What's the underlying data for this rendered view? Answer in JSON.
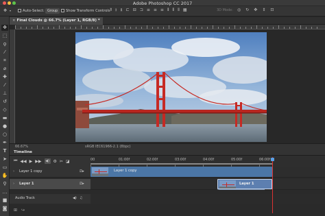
{
  "window": {
    "title": "Adobe Photoshop CC 2017"
  },
  "options_bar": {
    "auto_select_label": "Auto-Select:",
    "auto_select_value": "Group",
    "show_transform_label": "Show Transform Controls",
    "mode_3d_label": "3D Mode:"
  },
  "document": {
    "tab_title": "Final Clouds @ 66.7% (Layer 1, RGB/8) *",
    "zoom": "66.67%",
    "color_profile": "sRGB IEC61966-2.1 (8bpc)"
  },
  "timeline": {
    "panel_title": "Timeline",
    "time_labels": [
      "00",
      "01:00f",
      "02:00f",
      "03:00f",
      "04:00f",
      "05:00f",
      "06:00f"
    ],
    "layers": [
      {
        "name": "Layer 1 copy",
        "clip_label": "Layer 1 copy",
        "selected": false
      },
      {
        "name": "Layer 1",
        "clip_label": "Layer 1",
        "selected": true
      }
    ],
    "audio_track_label": "Audio Track"
  },
  "colors": {
    "accent": "#3f73b8",
    "clip_copy": "#4b76a6",
    "clip_selected": "#5d7fb0",
    "playhead": "#d33333"
  },
  "icons": {
    "tools": [
      "move-icon",
      "marquee-icon",
      "lasso-icon",
      "quick-select-icon",
      "crop-icon",
      "eyedropper-icon",
      "healing-brush-icon",
      "brush-icon",
      "clone-stamp-icon",
      "history-brush-icon",
      "eraser-icon",
      "gradient-icon",
      "blur-icon",
      "dodge-icon",
      "pen-icon",
      "type-icon",
      "path-select-icon",
      "rectangle-icon",
      "hand-icon",
      "zoom-icon"
    ]
  }
}
